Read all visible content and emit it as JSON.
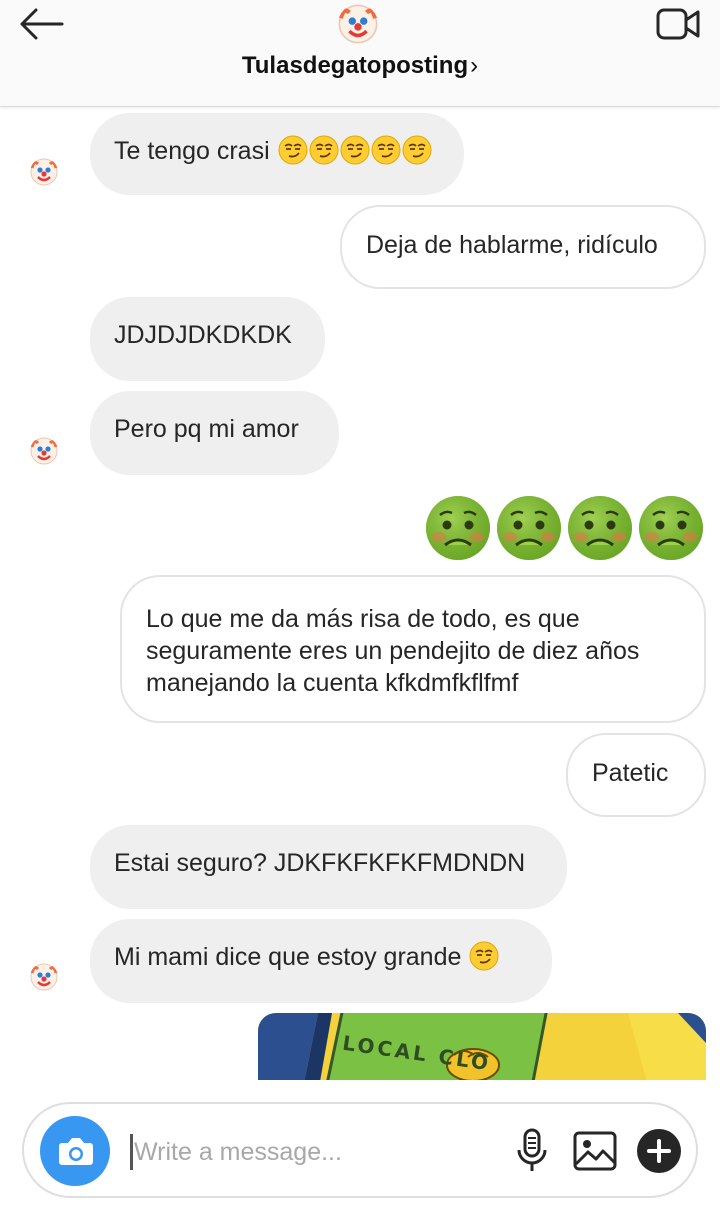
{
  "header": {
    "title": "Tulasdegatoposting",
    "chevron": "›",
    "icons": [
      "arrow-left-icon",
      "clown-avatar-icon",
      "video-camera-icon"
    ]
  },
  "messages": [
    {
      "side": "in",
      "text": "Te tengo crasi",
      "emoji": "smirk x5"
    },
    {
      "side": "out",
      "text": "Deja de hablarme, ridículo"
    },
    {
      "side": "in",
      "text": "JDJDJDKDKDK"
    },
    {
      "side": "in",
      "text": "Pero pq mi amor"
    },
    {
      "side": "out",
      "emoji": "nauseated-face x4"
    },
    {
      "side": "out",
      "text": "Lo que me da más risa de todo, es que seguramente eres un pendejito de diez años manejando la cuenta kfkdmfkflfmf"
    },
    {
      "side": "out",
      "text": "Patetic"
    },
    {
      "side": "in",
      "text": "Estai seguro? JDKFKFKFKFMDNDN"
    },
    {
      "side": "in",
      "text": "Mi mami dice que estoy grande",
      "emoji": "smirk"
    },
    {
      "side": "out",
      "image": "cartoon-image",
      "image_text": "LOCAL CLO"
    }
  ],
  "composer": {
    "placeholder": "Write a message...",
    "value": "",
    "icons": [
      "camera-icon",
      "microphone-icon",
      "gallery-icon",
      "plus-icon"
    ]
  },
  "colors": {
    "accent": "#3897f0",
    "incoming_bubble": "#efefef",
    "outgoing_border": "#e3e3e3",
    "sick_face": "#7cb930"
  }
}
